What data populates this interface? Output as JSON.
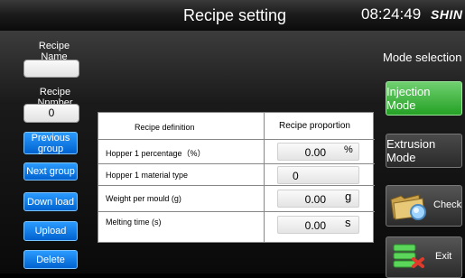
{
  "header": {
    "title": "Recipe setting",
    "clock": "08:24:49",
    "logo": "SHIN"
  },
  "left": {
    "recipe_name_label": "Recipe Name",
    "recipe_name_value": "",
    "recipe_number_label": "Recipe Nnmber",
    "recipe_number_value": "0",
    "buttons": {
      "previous_group": "Previous group",
      "next_group": "Next group",
      "download": "Down load",
      "upload": "Upload",
      "delete": "Delete"
    }
  },
  "table": {
    "col_definition": "Recipe definition",
    "col_proportion": "Recipe proportion",
    "rows": [
      {
        "label": "Hopper 1 percentage（%）",
        "value": "0.00",
        "unit": "%"
      },
      {
        "label": "Hopper 1 material type",
        "value": "0",
        "unit": ""
      },
      {
        "label": "Weight per mould (g)",
        "value": "0.00",
        "unit": "g"
      },
      {
        "label": "Melting time (s)",
        "value": "0.00",
        "unit": "s"
      }
    ]
  },
  "right": {
    "mode_selection_label": "Mode selection",
    "injection_mode": "Injection Mode",
    "extrusion_mode": "Extrusion Mode",
    "check": "Check",
    "exit": "Exit"
  },
  "colors": {
    "accent_blue": "#0a7ff0",
    "active_green": "#3cb43c"
  }
}
